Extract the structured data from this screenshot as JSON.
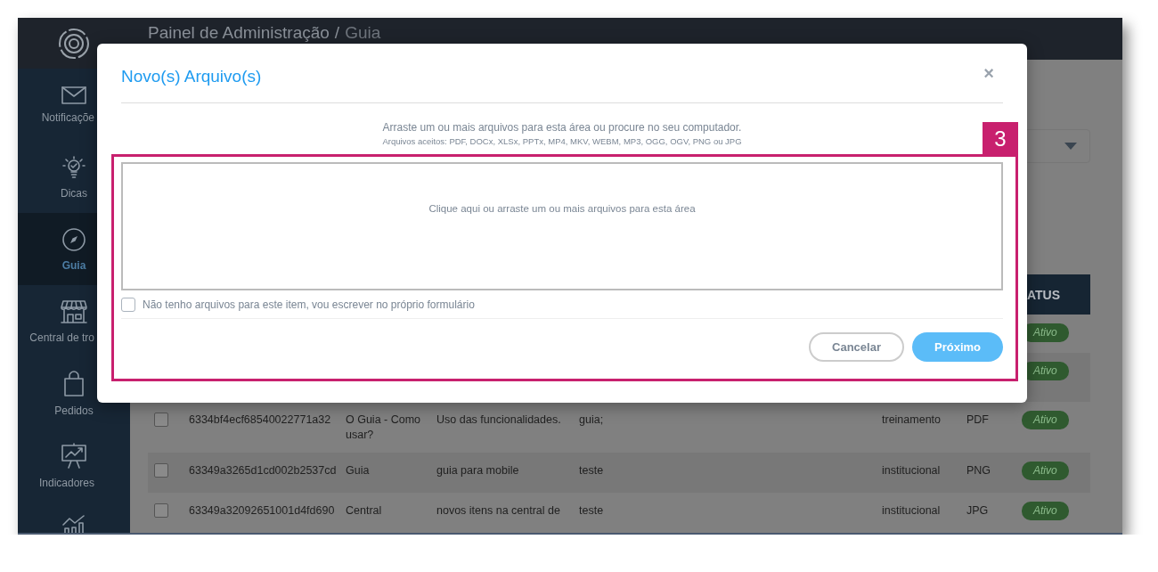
{
  "header": {
    "title": "Painel de Administração",
    "separator": "/",
    "breadcrumb": "Guia"
  },
  "sidebar": {
    "items": [
      {
        "label": "Notificaçõe",
        "selected": false
      },
      {
        "label": "Dicas",
        "selected": false
      },
      {
        "label": "Guia",
        "selected": true
      },
      {
        "label": "Central de tro",
        "selected": false
      },
      {
        "label": "Pedidos",
        "selected": false
      },
      {
        "label": "Indicadores",
        "selected": false
      },
      {
        "selected": false
      }
    ]
  },
  "table": {
    "status_heading": "ATUS",
    "rows": [
      {
        "status": "Ativo"
      },
      {
        "status": "Ativo"
      },
      {
        "checked": false,
        "id": "6334bf4ecf68540022771a32",
        "title": "O Guia - Como usar?",
        "description": "Uso das funcionalidades.",
        "tags": "guia;",
        "category": "treinamento",
        "type": "PDF",
        "status": "Ativo"
      },
      {
        "checked": false,
        "id": "63349a3265d1cd002b2537cd",
        "title": "Guia",
        "description": "guia para mobile",
        "tags": "teste",
        "category": "institucional",
        "type": "PNG",
        "status": "Ativo"
      },
      {
        "checked": false,
        "id": "63349a32092651001d4fd690",
        "title": "Central",
        "description": "novos itens na central de",
        "tags": "teste",
        "category": "institucional",
        "type": "JPG",
        "status": "Ativo"
      }
    ]
  },
  "modal": {
    "title": "Novo(s) Arquivo(s)",
    "close": "×",
    "instructions": "Arraste um ou mais arquivos para esta área ou procure no seu computador.",
    "accepted": "Arquivos aceitos: PDF, DOCx, XLSx, PPTx, MP4, MKV, WEBM, MP3, OGG, OGV, PNG ou JPG",
    "dropzone": "Clique aqui ou arraste um ou mais arquivos para esta área",
    "no_files": {
      "label": "Não tenho arquivos para este item, vou escrever no próprio formulário",
      "checked": false
    },
    "buttons": [
      {
        "label": "Cancelar",
        "kind": "secondary"
      },
      {
        "label": "Próximo",
        "kind": "primary"
      }
    ]
  },
  "callout": {
    "number": "3"
  }
}
